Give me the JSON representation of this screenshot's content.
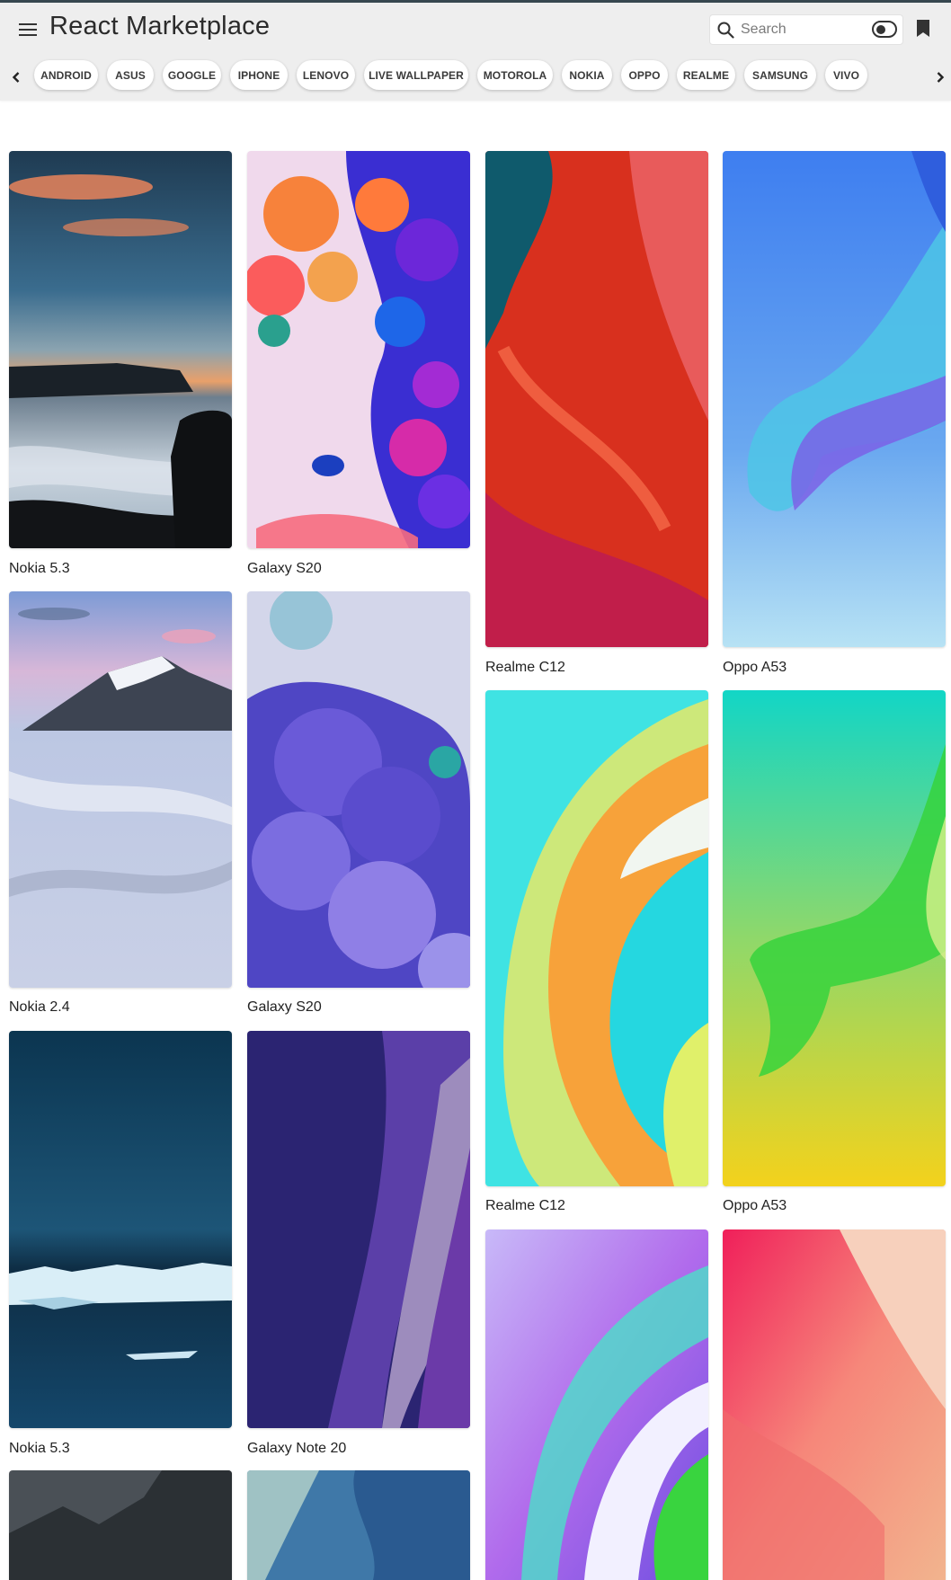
{
  "app": {
    "title": "React Marketplace"
  },
  "search": {
    "placeholder": "Search",
    "value": ""
  },
  "categories": [
    "ANDROID",
    "ASUS",
    "GOOGLE",
    "IPHONE",
    "LENOVO",
    "LIVE WALLPAPER",
    "MOTOROLA",
    "NOKIA",
    "OPPO",
    "REALME",
    "SAMSUNG",
    "VIVO"
  ],
  "wallpapers": [
    {
      "label": "Nokia 5.3"
    },
    {
      "label": "Galaxy S20"
    },
    {
      "label": "Realme C12"
    },
    {
      "label": "Oppo A53"
    },
    {
      "label": "Nokia 2.4"
    },
    {
      "label": "Galaxy S20"
    },
    {
      "label": "Realme C12"
    },
    {
      "label": "Oppo A53"
    },
    {
      "label": "Nokia 5.3"
    },
    {
      "label": "Galaxy Note 20"
    }
  ],
  "icons": {
    "menu": "menu-icon",
    "search": "search-icon",
    "theme_toggle": "dark-mode-toggle",
    "bookmark": "bookmark-icon",
    "scroll_left": "chevron-left-icon",
    "scroll_right": "chevron-right-icon"
  },
  "colors": {
    "appbar": "#eeeeee",
    "accent": "#37474f",
    "chip_bg": "#ffffff"
  }
}
